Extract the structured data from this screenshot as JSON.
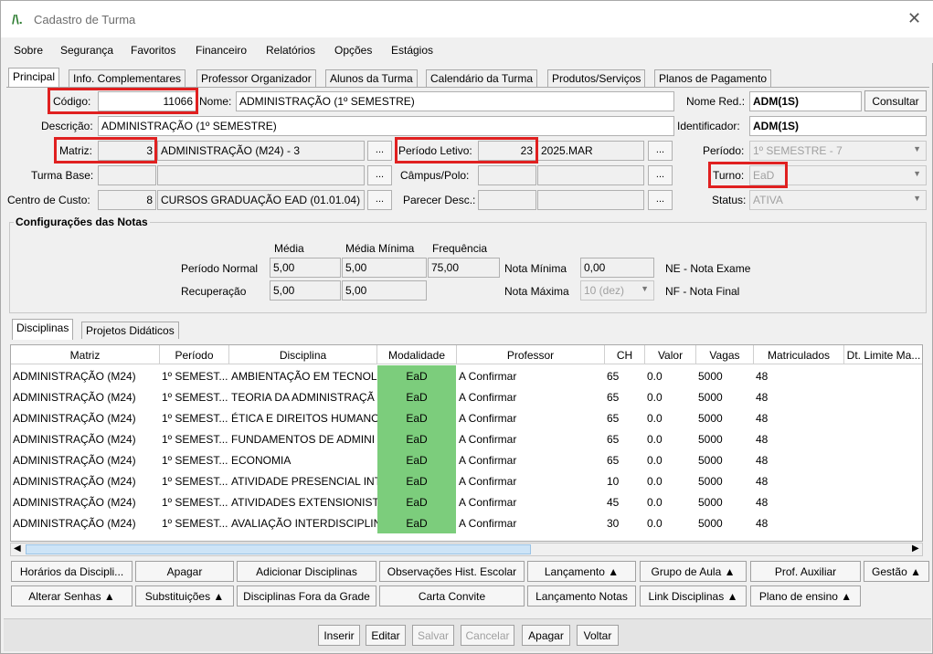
{
  "window": {
    "title": "Cadastro de Turma"
  },
  "menu": [
    "Sobre",
    "Segurança",
    "Favoritos",
    "Financeiro",
    "Relatórios",
    "Opções",
    "Estágios"
  ],
  "tabs": [
    "Principal",
    "Info. Complementares",
    "Professor Organizador",
    "Alunos da Turma",
    "Calendário da Turma",
    "Produtos/Serviços",
    "Planos de Pagamento"
  ],
  "form": {
    "codigo_label": "Código:",
    "codigo": "11066",
    "nome_label": "Nome:",
    "nome": "ADMINISTRAÇÃO (1º SEMESTRE)",
    "nome_red_label": "Nome Red.:",
    "nome_red": "ADM(1S)",
    "consultar": "Consultar",
    "descricao_label": "Descrição:",
    "descricao": "ADMINISTRAÇÃO (1º SEMESTRE)",
    "identificador_label": "Identificador:",
    "identificador": "ADM(1S)",
    "matriz_label": "Matriz:",
    "matriz_id": "3",
    "matriz": "ADMINISTRAÇÃO (M24) - 3",
    "periodo_letivo_label": "Período Letivo:",
    "periodo_letivo_id": "23",
    "periodo_letivo": "2025.MAR",
    "periodo_label": "Período:",
    "periodo": "1º SEMESTRE - 7",
    "turma_base_label": "Turma Base:",
    "campus_label": "Câmpus/Polo:",
    "turno_label": "Turno:",
    "turno": "EaD",
    "centro_label": "Centro de Custo:",
    "centro_id": "8",
    "centro": "CURSOS GRADUAÇÃO EAD (01.01.04)",
    "parecer_label": "Parecer Desc.:",
    "status_label": "Status:",
    "status": "ATIVA",
    "dots": "..."
  },
  "notas": {
    "title": "Configurações das Notas",
    "media": "Média",
    "media_minima": "Média Mínima",
    "frequencia": "Frequência",
    "periodo_normal": "Período Normal",
    "pn_media": "5,00",
    "pn_media_min": "5,00",
    "pn_freq": "75,00",
    "recuperacao": "Recuperação",
    "rec_media": "5,00",
    "rec_media_min": "5,00",
    "nota_minima_label": "Nota Mínima",
    "nota_minima": "0,00",
    "nota_maxima_label": "Nota Máxima",
    "nota_maxima": "10 (dez)",
    "ne": "NE - Nota Exame",
    "nf": "NF - Nota Final"
  },
  "subtabs": [
    "Disciplinas",
    "Projetos Didáticos"
  ],
  "grid": {
    "headers": [
      "Matriz",
      "Período",
      "Disciplina",
      "Modalidade",
      "Professor",
      "CH",
      "Valor",
      "Vagas",
      "Matriculados",
      "Dt. Limite Ma..."
    ],
    "rows": [
      [
        "ADMINISTRAÇÃO (M24)",
        "1º SEMEST...",
        "AMBIENTAÇÃO EM TECNOL",
        "EaD",
        "A Confirmar",
        "65",
        "0.0",
        "5000",
        "48"
      ],
      [
        "ADMINISTRAÇÃO (M24)",
        "1º SEMEST...",
        "TEORIA DA ADMINISTRAÇÃ",
        "EaD",
        "A Confirmar",
        "65",
        "0.0",
        "5000",
        "48"
      ],
      [
        "ADMINISTRAÇÃO (M24)",
        "1º SEMEST...",
        "ÉTICA E DIREITOS HUMANO",
        "EaD",
        "A Confirmar",
        "65",
        "0.0",
        "5000",
        "48"
      ],
      [
        "ADMINISTRAÇÃO (M24)",
        "1º SEMEST...",
        "FUNDAMENTOS DE ADMINI",
        "EaD",
        "A Confirmar",
        "65",
        "0.0",
        "5000",
        "48"
      ],
      [
        "ADMINISTRAÇÃO (M24)",
        "1º SEMEST...",
        "ECONOMIA",
        "EaD",
        "A Confirmar",
        "65",
        "0.0",
        "5000",
        "48"
      ],
      [
        "ADMINISTRAÇÃO (M24)",
        "1º SEMEST...",
        "ATIVIDADE PRESENCIAL INTI",
        "EaD",
        "A Confirmar",
        "10",
        "0.0",
        "5000",
        "48"
      ],
      [
        "ADMINISTRAÇÃO (M24)",
        "1º SEMEST...",
        "ATIVIDADES EXTENSIONISTA",
        "EaD",
        "A Confirmar",
        "45",
        "0.0",
        "5000",
        "48"
      ],
      [
        "ADMINISTRAÇÃO (M24)",
        "1º SEMEST...",
        "AVALIAÇÃO INTERDISCIPLIN",
        "EaD",
        "A Confirmar",
        "30",
        "0.0",
        "5000",
        "48"
      ]
    ]
  },
  "actions_row1": [
    "Horários da Discipli...",
    "Apagar",
    "Adicionar Disciplinas",
    "Observações Hist. Escolar",
    "Lançamento ▲",
    "Grupo de Aula ▲",
    "Prof. Auxiliar",
    "Gestão ▲"
  ],
  "actions_row2": [
    "Alterar Senhas ▲",
    "Substituições ▲",
    "Disciplinas Fora da Grade",
    "Carta Convite",
    "Lançamento Notas",
    "Link Disciplinas ▲",
    "Plano de ensino ▲"
  ],
  "bottom": [
    "Inserir",
    "Editar",
    "Salvar",
    "Cancelar",
    "Apagar",
    "Voltar"
  ]
}
